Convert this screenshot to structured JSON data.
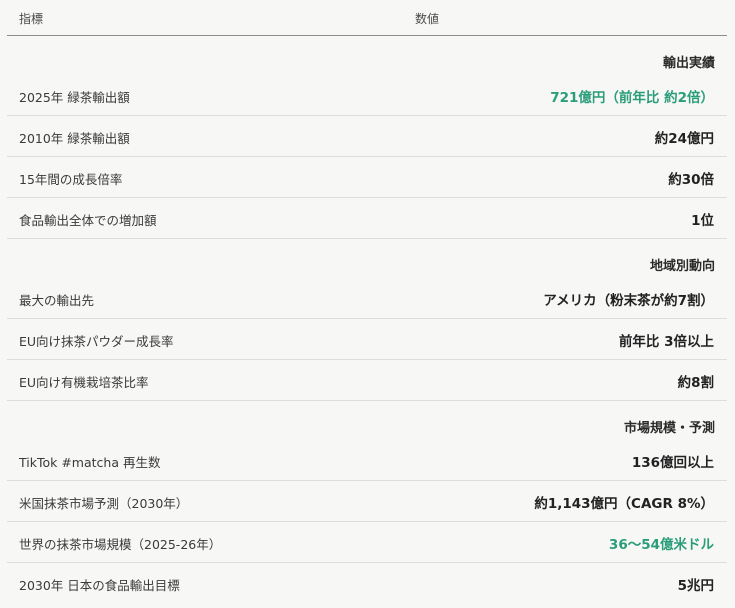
{
  "header": {
    "col_indicator": "指標",
    "col_value": "数値"
  },
  "sections": [
    {
      "title": "輸出実績"
    },
    {
      "title": "地域別動向"
    },
    {
      "title": "市場規模・予測"
    }
  ],
  "rows": [
    {
      "label": "2025年 緑茶輸出額",
      "value": "721億円（前年比 約2倍）",
      "accent": true
    },
    {
      "label": "2010年 緑茶輸出額",
      "value": "約24億円"
    },
    {
      "label": "15年間の成長倍率",
      "value": "約30倍"
    },
    {
      "label": "食品輸出全体での増加額",
      "value": "1位"
    },
    {
      "label": "最大の輸出先",
      "value": "アメリカ（粉末茶が約7割）"
    },
    {
      "label": "EU向け抹茶パウダー成長率",
      "value": "前年比 3倍以上"
    },
    {
      "label": "EU向け有機栽培茶比率",
      "value": "約8割"
    },
    {
      "label": "TikTok #matcha 再生数",
      "value": "136億回以上"
    },
    {
      "label": "米国抹茶市場予測（2030年）",
      "value": "約1,143億円（CAGR 8%）"
    },
    {
      "label": "世界の抹茶市場規模（2025-26年）",
      "value": "36〜54億米ドル",
      "accent": true
    },
    {
      "label": "2030年 日本の食品輸出目標",
      "value": "5兆円"
    }
  ],
  "colors": {
    "accent": "#2a9d7a",
    "rule": "#8c8c8c",
    "row_border": "#dddddb",
    "background": "#f7f7f5"
  }
}
